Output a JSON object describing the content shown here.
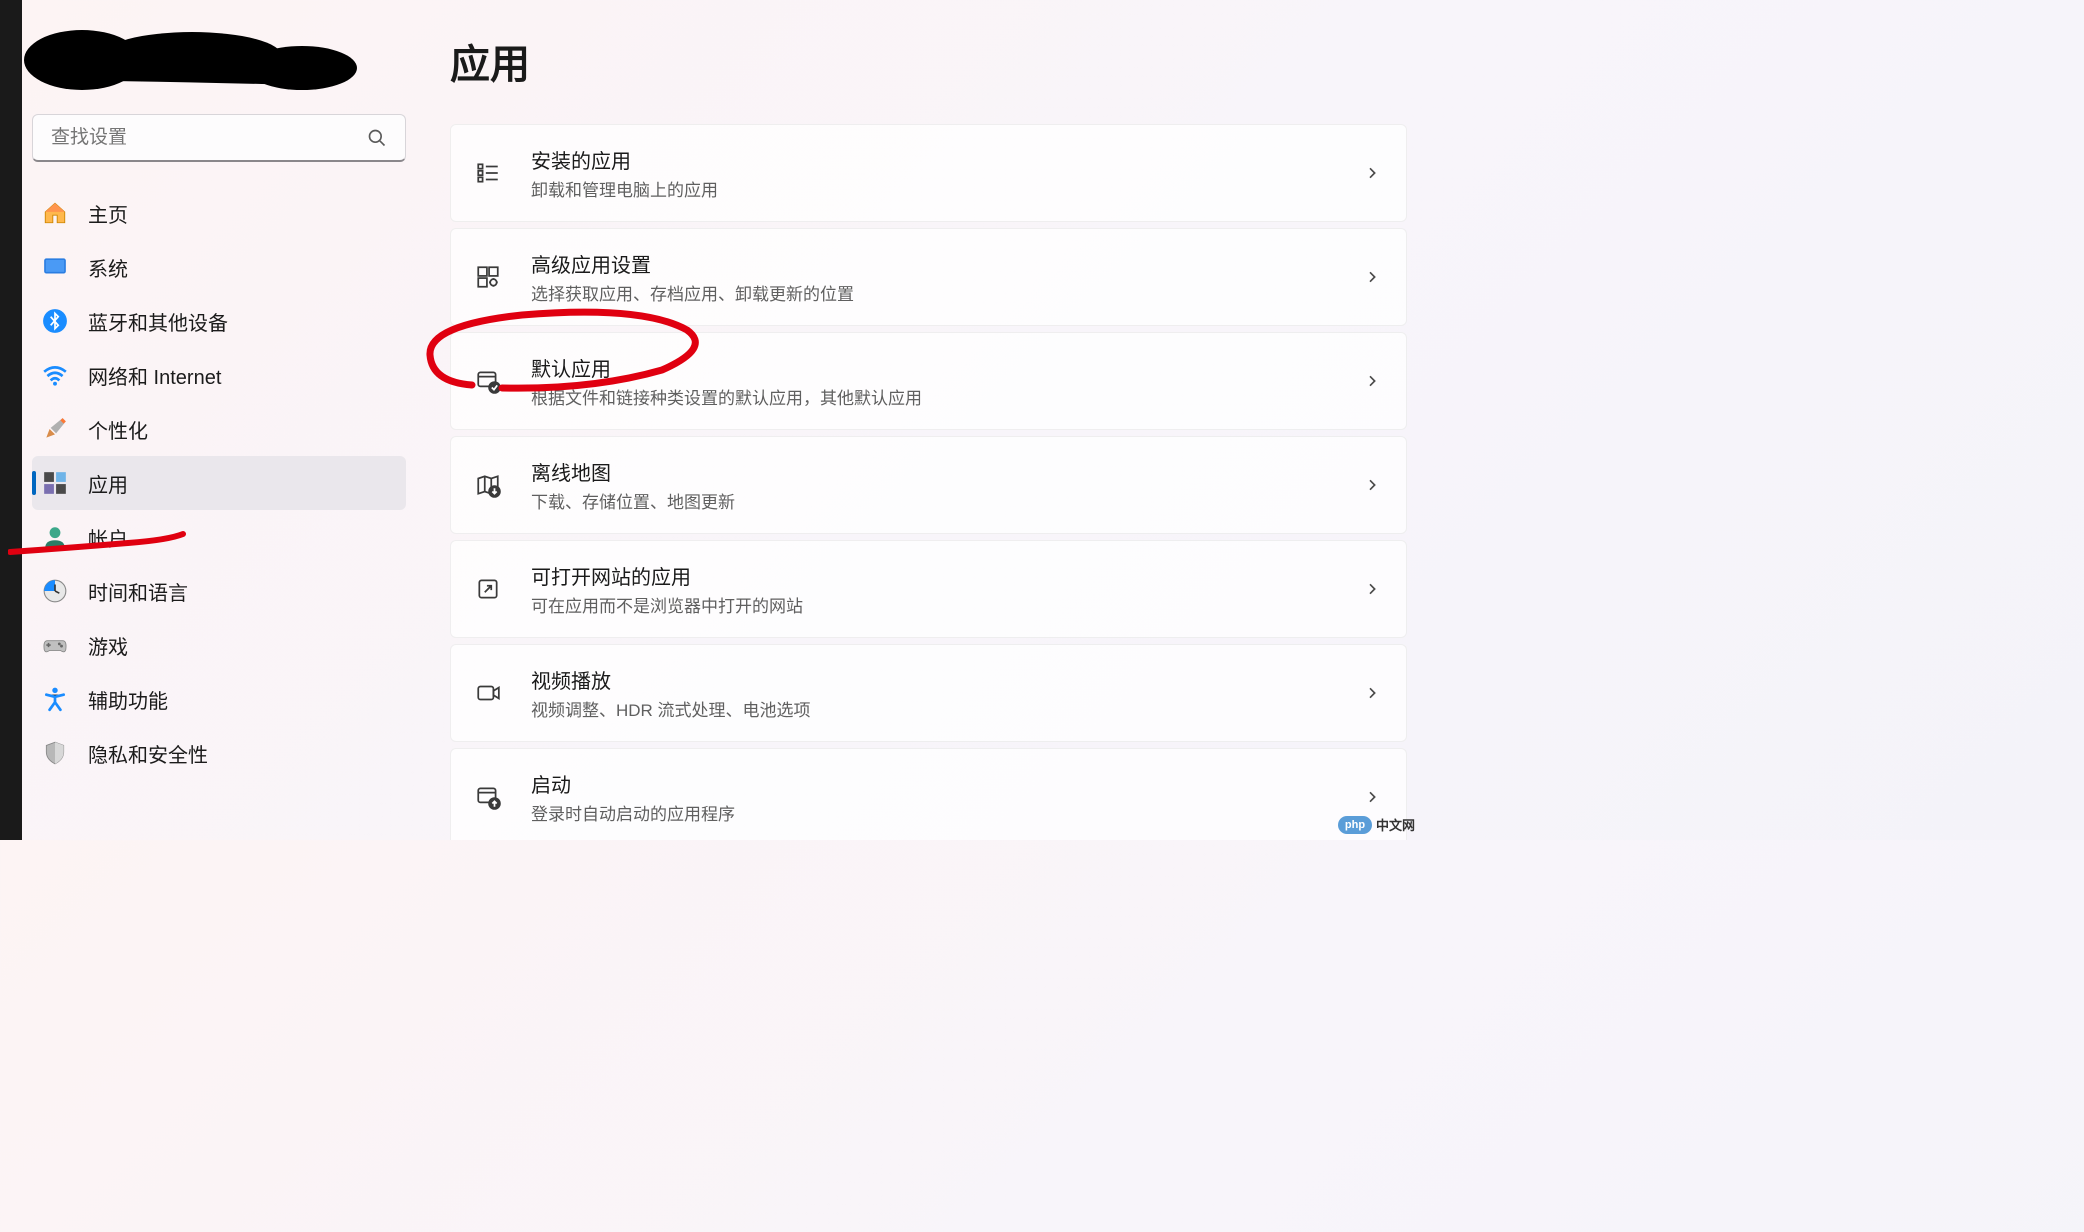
{
  "search_placeholder": "查找设置",
  "page_title": "应用",
  "nav": [
    {
      "label": "主页",
      "icon": "home"
    },
    {
      "label": "系统",
      "icon": "system"
    },
    {
      "label": "蓝牙和其他设备",
      "icon": "bluetooth"
    },
    {
      "label": "网络和 Internet",
      "icon": "wifi"
    },
    {
      "label": "个性化",
      "icon": "brush"
    },
    {
      "label": "应用",
      "icon": "apps",
      "active": true
    },
    {
      "label": "帐户",
      "icon": "account"
    },
    {
      "label": "时间和语言",
      "icon": "time"
    },
    {
      "label": "游戏",
      "icon": "game"
    },
    {
      "label": "辅助功能",
      "icon": "access"
    },
    {
      "label": "隐私和安全性",
      "icon": "privacy"
    }
  ],
  "cards": [
    {
      "title": "安装的应用",
      "desc": "卸载和管理电脑上的应用",
      "icon": "installed"
    },
    {
      "title": "高级应用设置",
      "desc": "选择获取应用、存档应用、卸载更新的位置",
      "icon": "advanced"
    },
    {
      "title": "默认应用",
      "desc": "根据文件和链接种类设置的默认应用，其他默认应用",
      "icon": "default"
    },
    {
      "title": "离线地图",
      "desc": "下载、存储位置、地图更新",
      "icon": "maps"
    },
    {
      "title": "可打开网站的应用",
      "desc": "可在应用而不是浏览器中打开的网站",
      "icon": "websites"
    },
    {
      "title": "视频播放",
      "desc": "视频调整、HDR 流式处理、电池选项",
      "icon": "video"
    },
    {
      "title": "启动",
      "desc": "登录时自动启动的应用程序",
      "icon": "startup"
    }
  ],
  "watermark_text": "中文网",
  "watermark_logo": "php"
}
